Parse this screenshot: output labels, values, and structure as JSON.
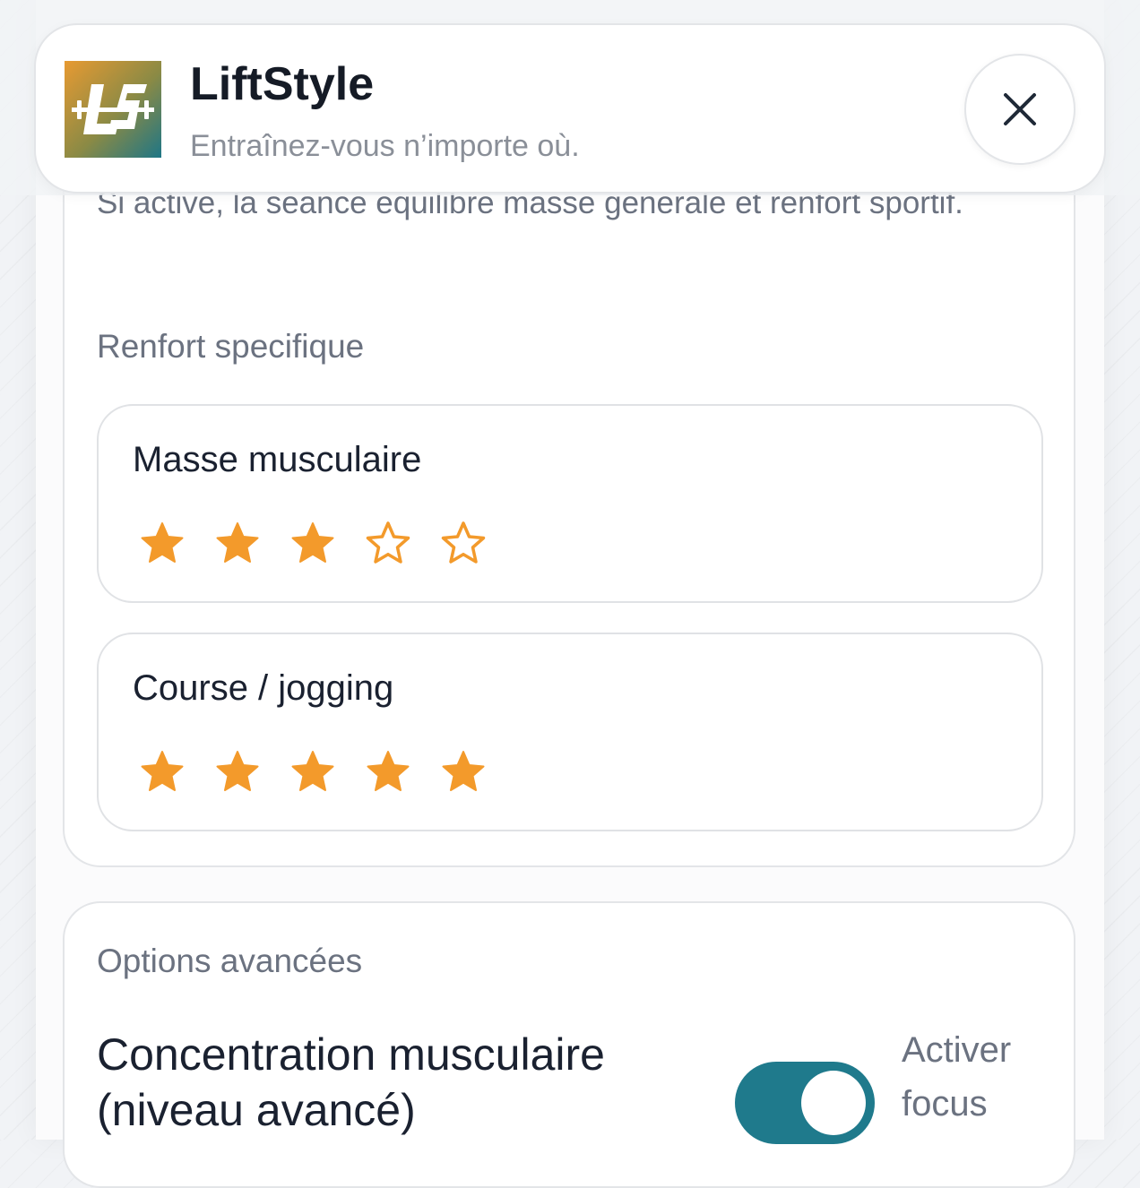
{
  "header": {
    "title": "LiftStyle",
    "subtitle": "Entraînez-vous n’importe où."
  },
  "intro": {
    "description": "Si active, la seance equilibre masse generale et renfort sportif."
  },
  "renfort": {
    "label": "Renfort specifique",
    "items": [
      {
        "name": "Masse musculaire",
        "rating": 3,
        "max": 5
      },
      {
        "name": "Course / jogging",
        "rating": 5,
        "max": 5
      }
    ]
  },
  "advanced": {
    "label": "Options avancées",
    "option_title": "Concentration musculaire (niveau avancé)",
    "toggle_label": "Activer focus",
    "toggle_on": true
  },
  "colors": {
    "star": "#f39a2b",
    "toggle": "#1f7a8c"
  },
  "icons": {
    "logo": "liftstyle-logo-icon",
    "close": "close-icon",
    "star_filled": "star-filled-icon",
    "star_empty": "star-outline-icon"
  }
}
